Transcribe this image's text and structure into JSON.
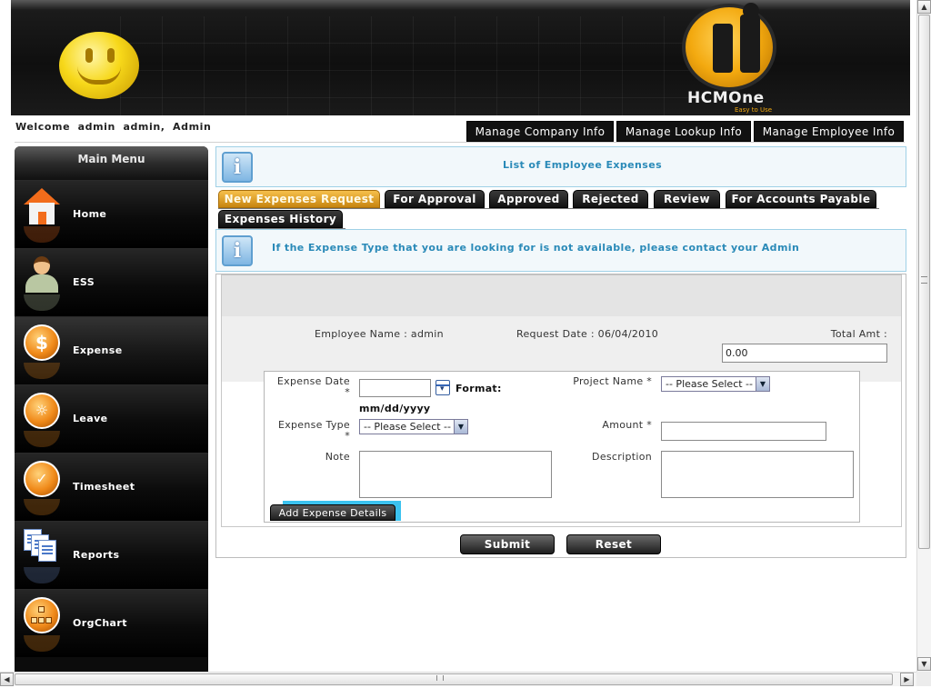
{
  "brand": {
    "name": "HCMOne",
    "tagline": "Easy to Use"
  },
  "welcome": {
    "prefix": "Welcome",
    "first": "admin",
    "last": "admin,",
    "role": "Admin"
  },
  "top_nav": [
    "Manage Company Info",
    "Manage Lookup Info",
    "Manage Employee Info"
  ],
  "sidebar": {
    "title": "Main Menu",
    "items": [
      {
        "label": "Home",
        "icon": "home-icon"
      },
      {
        "label": "ESS",
        "icon": "person-icon"
      },
      {
        "label": "Expense",
        "icon": "dollar-coin-icon"
      },
      {
        "label": "Leave",
        "icon": "leave-coin-icon"
      },
      {
        "label": "Timesheet",
        "icon": "timesheet-coin-icon"
      },
      {
        "label": "Reports",
        "icon": "reports-icon"
      },
      {
        "label": "OrgChart",
        "icon": "orgchart-icon"
      }
    ],
    "active": "Expense"
  },
  "page": {
    "title": "List of Employee Expenses",
    "notice": "If the Expense Type that you are looking for is not available, please contact your Admin"
  },
  "tabs": [
    "New Expenses Request",
    "For Approval",
    "Approved",
    "Rejected",
    "Review",
    "For Accounts Payable",
    "Expenses History"
  ],
  "active_tab": "New Expenses Request",
  "form": {
    "employee_name_label": "Employee Name : admin",
    "request_date_label": "Request Date : 06/04/2010",
    "total_amt_label": "Total Amt :",
    "total_amt_value": "0.00",
    "expense_date_label": "Expense Date",
    "required_mark": "*",
    "format_label": "Format:",
    "format_value": "mm/dd/yyyy",
    "project_name_label": "Project Name *",
    "project_select": "-- Please Select --",
    "expense_type_label": "Expense Type",
    "expense_type_select": "-- Please Select --",
    "amount_label": "Amount *",
    "note_label": "Note",
    "description_label": "Description",
    "add_details_label": "Add Expense Details"
  },
  "actions": {
    "submit": "Submit",
    "reset": "Reset"
  },
  "colors": {
    "accent_blue": "#2a8ab8",
    "active_tab": "#f6c04c",
    "scroll_accent": "#3bc2ef"
  }
}
